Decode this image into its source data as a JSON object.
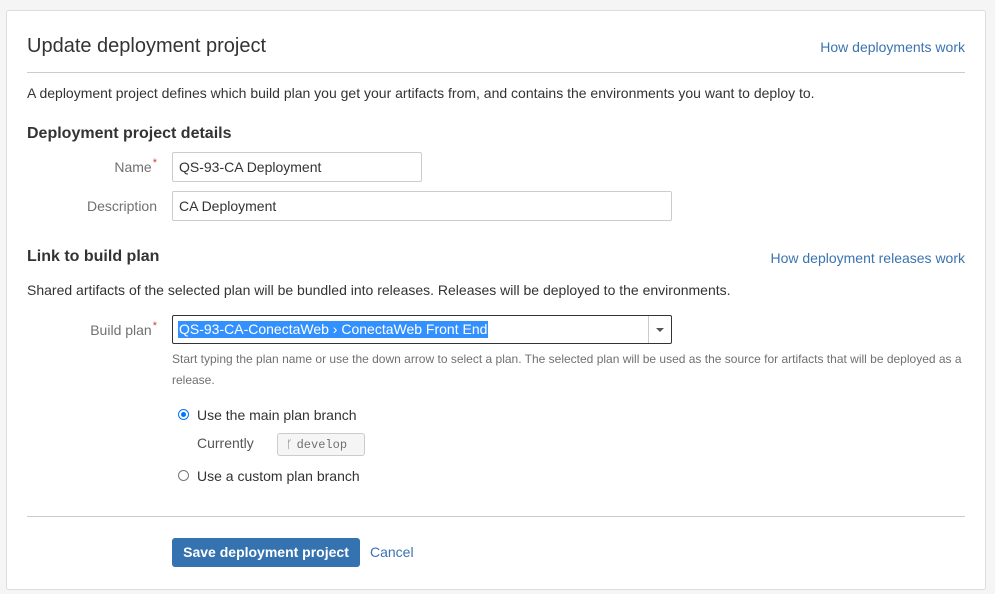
{
  "header": {
    "title": "Update deployment project",
    "help_link": "How deployments work"
  },
  "intro": "A deployment project defines which build plan you get your artifacts from, and contains the environments you want to deploy to.",
  "details": {
    "heading": "Deployment project details",
    "name_label": "Name",
    "name_value": "QS-93-CA Deployment",
    "description_label": "Description",
    "description_value": "CA Deployment",
    "required_marker": "*"
  },
  "build_plan": {
    "heading": "Link to build plan",
    "help_link": "How deployment releases work",
    "info": "Shared artifacts of the selected plan will be bundled into releases. Releases will be deployed to the environments.",
    "label": "Build plan",
    "selected": "QS-93-CA-ConectaWeb › ConectaWeb Front End",
    "help_text": "Start typing the plan name or use the down arrow to select a plan. The selected plan will be used as the source for artifacts that will be deployed as a release.",
    "options": {
      "main_branch": "Use the main plan branch",
      "currently_label": "Currently",
      "current_branch": "develop",
      "custom_branch": "Use a custom plan branch"
    }
  },
  "actions": {
    "save": "Save deployment project",
    "cancel": "Cancel"
  },
  "colors": {
    "link": "#3b73af",
    "primary": "#3572b0",
    "required": "#d04437",
    "selection": "#3390ff"
  }
}
